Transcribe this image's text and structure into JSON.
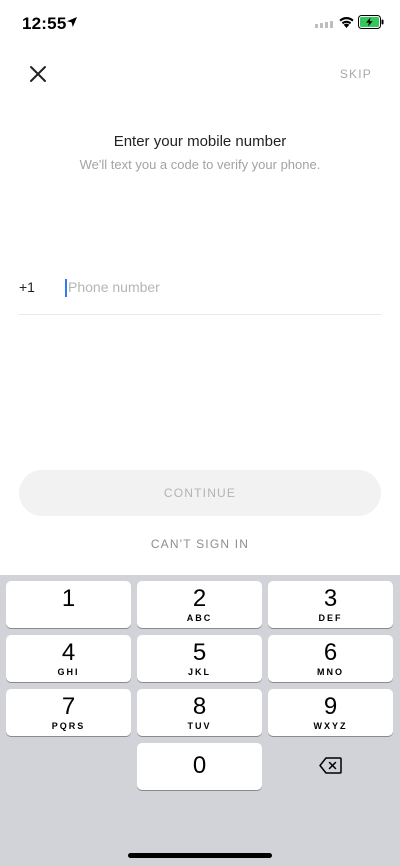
{
  "status_bar": {
    "time": "12:55",
    "icons": [
      "location-arrow-icon",
      "cellular-signal-icon",
      "wifi-icon",
      "battery-charging-icon"
    ],
    "battery_color": "#34c759"
  },
  "header": {
    "close_icon": "close-icon",
    "skip_label": "SKIP"
  },
  "main": {
    "title": "Enter your mobile number",
    "subtitle": "We'll text you a code to verify your phone.",
    "country_code": "+1",
    "phone_value": "",
    "phone_placeholder": "Phone number",
    "continue_label": "CONTINUE",
    "cant_sign_in_label": "CAN'T SIGN IN"
  },
  "keypad": {
    "keys": [
      {
        "digit": "1",
        "letters": ""
      },
      {
        "digit": "2",
        "letters": "ABC"
      },
      {
        "digit": "3",
        "letters": "DEF"
      },
      {
        "digit": "4",
        "letters": "GHI"
      },
      {
        "digit": "5",
        "letters": "JKL"
      },
      {
        "digit": "6",
        "letters": "MNO"
      },
      {
        "digit": "7",
        "letters": "PQRS"
      },
      {
        "digit": "8",
        "letters": "TUV"
      },
      {
        "digit": "9",
        "letters": "WXYZ"
      }
    ],
    "zero": {
      "digit": "0",
      "letters": ""
    },
    "delete_icon": "backspace-icon"
  },
  "colors": {
    "background": "#ffffff",
    "keypad_background": "#d1d3d9",
    "caret": "#2f7bf5",
    "muted_text": "#a9a9a9"
  }
}
